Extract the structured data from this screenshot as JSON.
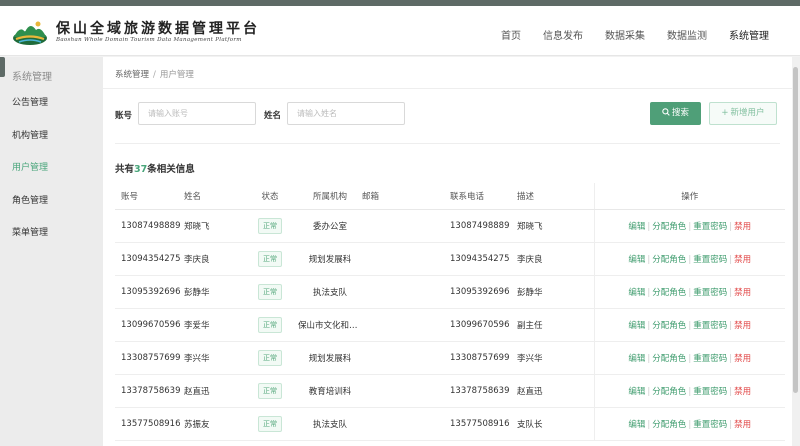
{
  "brand": {
    "title": "保山全域旅游数据管理平台",
    "subtitle": "Baoshan Whole Domain Tourism Data Management Platform",
    "colors": {
      "accent": "#48a57a",
      "danger": "#e24a4a",
      "dark": "#5e6a66"
    }
  },
  "topnav": [
    {
      "label": "首页",
      "active": false
    },
    {
      "label": "信息发布",
      "active": false
    },
    {
      "label": "数据采集",
      "active": false
    },
    {
      "label": "数据监测",
      "active": false
    },
    {
      "label": "系统管理",
      "active": true
    }
  ],
  "sidebar": {
    "title": "系统管理",
    "items": [
      {
        "label": "公告管理",
        "active": false
      },
      {
        "label": "机构管理",
        "active": false
      },
      {
        "label": "用户管理",
        "active": true
      },
      {
        "label": "角色管理",
        "active": false
      },
      {
        "label": "菜单管理",
        "active": false
      }
    ]
  },
  "breadcrumb": {
    "parent": "系统管理",
    "separator": "/",
    "current": "用户管理"
  },
  "filters": {
    "account_label": "账号",
    "account_placeholder": "请输入账号",
    "name_label": "姓名",
    "name_placeholder": "请输入姓名",
    "search_label": "搜索",
    "search_icon": "search-icon",
    "add_label": "新增用户",
    "add_icon": "plus-icon"
  },
  "summary": {
    "prefix": "共有",
    "count": "37",
    "suffix": "条相关信息"
  },
  "table": {
    "headers": {
      "account": "账号",
      "name": "姓名",
      "status": "状态",
      "org": "所属机构",
      "email": "邮箱",
      "phone": "联系电话",
      "desc": "描述",
      "ops": "操作"
    },
    "actions": {
      "edit": "编辑",
      "assign_role": "分配角色",
      "reset_password": "重置密码",
      "disable": "禁用",
      "sep": "|"
    },
    "rows": [
      {
        "account": "13087498889",
        "name": "郑晓飞",
        "status": "正常",
        "org": "委办公室",
        "email": "",
        "phone": "13087498889",
        "desc": "郑晓飞"
      },
      {
        "account": "13094354275",
        "name": "李庆良",
        "status": "正常",
        "org": "规划发展科",
        "email": "",
        "phone": "13094354275",
        "desc": "李庆良"
      },
      {
        "account": "13095392696",
        "name": "彭静华",
        "status": "正常",
        "org": "执法支队",
        "email": "",
        "phone": "13095392696",
        "desc": "彭静华"
      },
      {
        "account": "13099670596",
        "name": "李爱华",
        "status": "正常",
        "org": "保山市文化和旅…",
        "email": "",
        "phone": "13099670596",
        "desc": "副主任"
      },
      {
        "account": "13308757699",
        "name": "李兴华",
        "status": "正常",
        "org": "规划发展科",
        "email": "",
        "phone": "13308757699",
        "desc": "李兴华"
      },
      {
        "account": "13378758639",
        "name": "赵直迅",
        "status": "正常",
        "org": "教育培训科",
        "email": "",
        "phone": "13378758639",
        "desc": "赵直迅"
      },
      {
        "account": "13577508916",
        "name": "苏振友",
        "status": "正常",
        "org": "执法支队",
        "email": "",
        "phone": "13577508916",
        "desc": "支队长"
      }
    ]
  }
}
